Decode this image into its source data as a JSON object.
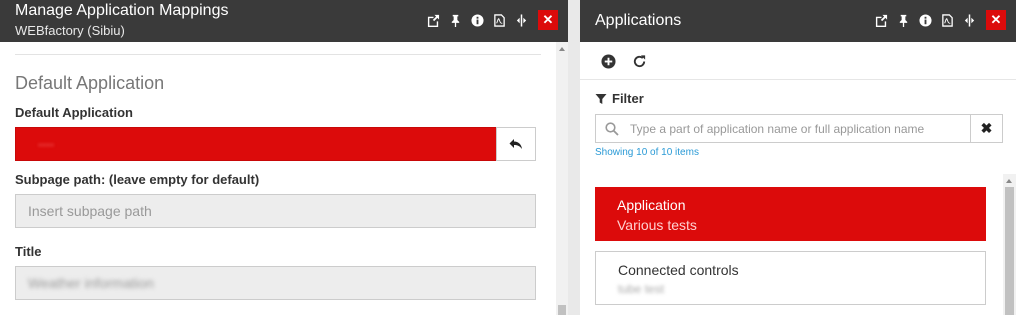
{
  "left_panel": {
    "title": "Manage Application Mappings",
    "subtitle": "WEBfactory (Sibiu)",
    "section_title": "Default Application",
    "default_app_label": "Default Application",
    "default_app_value": "----",
    "subpage_label": "Subpage path: (leave empty for default)",
    "subpage_placeholder": "Insert subpage path",
    "title_label": "Title",
    "title_value": "Weather information"
  },
  "right_panel": {
    "title": "Applications",
    "filter_label": "Filter",
    "search_placeholder": "Type a part of application name or full application name",
    "clear_label": "✖",
    "showing_text": "Showing 10 of 10 items",
    "items": [
      {
        "title": "Application",
        "subtitle": "Various tests",
        "active": true
      },
      {
        "title": "Connected controls",
        "subtitle": "tube test",
        "active": false
      }
    ]
  },
  "header_icons": [
    "popout-icon",
    "pin-icon",
    "info-icon",
    "pdf-icon",
    "resize-icon",
    "close-icon"
  ],
  "colors": {
    "header_bg": "#3a3a3a",
    "accent_red": "#dc0b0b",
    "link_blue": "#2a9ad6"
  }
}
